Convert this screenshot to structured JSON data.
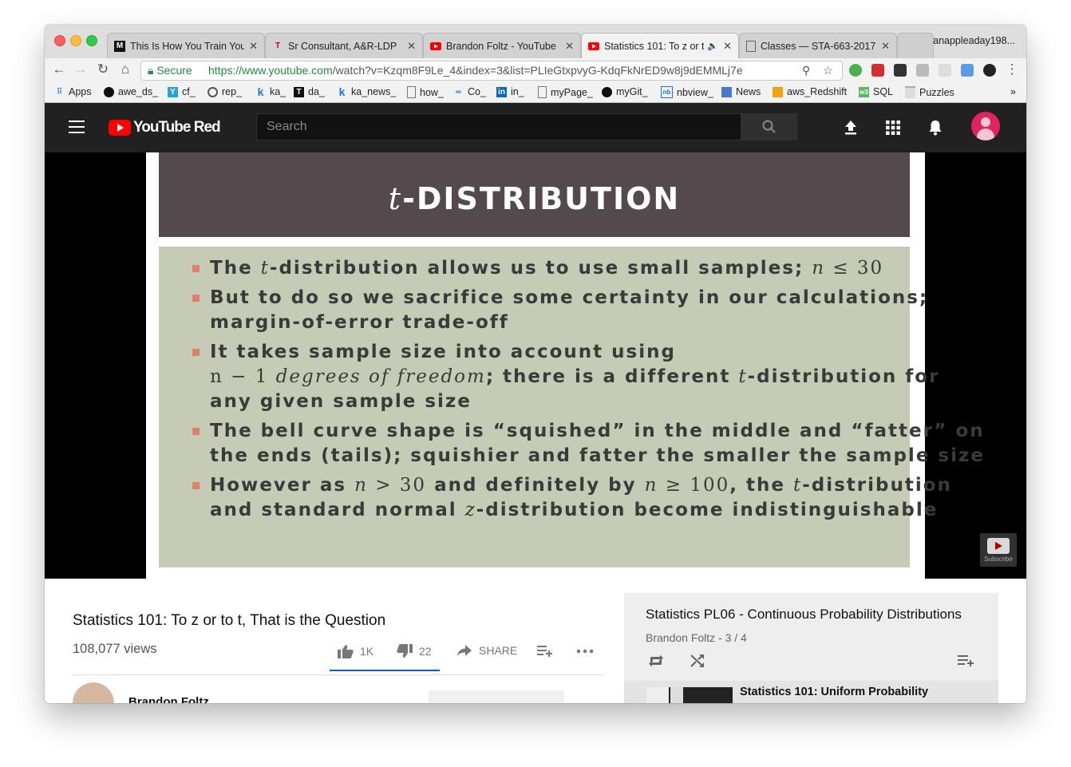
{
  "browser": {
    "tabs": [
      {
        "label": "This Is How You Train Your",
        "icon": "medium-icon"
      },
      {
        "label": "Sr Consultant, A&R-LDP",
        "icon": "tesla-icon"
      },
      {
        "label": "Brandon Foltz - YouTube",
        "icon": "youtube-icon"
      },
      {
        "label": "Statistics 101: To z or t",
        "icon": "youtube-icon",
        "active": true
      },
      {
        "label": "Classes — STA-663-2017",
        "icon": "page-icon"
      }
    ],
    "profile": "anappleaday198...",
    "secure_label": "Secure",
    "url_domain": "https://www.youtube.com",
    "url_rest": "/watch?v=Kzqm8F9Le_4&index=3&list=PLIeGtxpvyG-KdqFkNrED9w8j9dEMMLj7e",
    "bookmarks": [
      {
        "label": "Apps",
        "icon": "apps-icon"
      },
      {
        "label": "awe_ds_",
        "icon": "github-icon"
      },
      {
        "label": "cf_",
        "icon": "cf-icon"
      },
      {
        "label": "rep_",
        "icon": "rep-icon"
      },
      {
        "label": "ka_",
        "icon": "k-icon"
      },
      {
        "label": "da_",
        "icon": "t-icon"
      },
      {
        "label": "ka_news_",
        "icon": "k-icon"
      },
      {
        "label": "how_",
        "icon": "page-icon"
      },
      {
        "label": "Co_",
        "icon": "co-icon"
      },
      {
        "label": "in_",
        "icon": "linkedin-icon"
      },
      {
        "label": "myPage_",
        "icon": "page-icon"
      },
      {
        "label": "myGit_",
        "icon": "github-icon"
      },
      {
        "label": "nbview_",
        "icon": "nb-icon"
      },
      {
        "label": "News",
        "icon": "news-icon"
      },
      {
        "label": "aws_Redshift",
        "icon": "aws-icon"
      },
      {
        "label": "SQL",
        "icon": "sql-icon"
      },
      {
        "label": "Puzzles",
        "icon": "folder-icon"
      }
    ],
    "bookmarks_more": "»"
  },
  "youtube": {
    "logo_text": "YouTube Red",
    "search_placeholder": "Search"
  },
  "slide": {
    "title_italic": "t",
    "title_rest": "-DISTRIBUTION",
    "bullets": [
      {
        "lines": [
          [
            "The ",
            {
              "em": "t"
            },
            "-distribution allows us to use small samples; ",
            {
              "em": "n"
            },
            {
              "m": " ≤ 30"
            }
          ]
        ]
      },
      {
        "lines": [
          [
            "But to do so we sacrifice some certainty in our calculations;"
          ],
          [
            "margin-of-error trade-off"
          ]
        ]
      },
      {
        "lines": [
          [
            "It takes sample size into account using"
          ],
          [
            {
              "m": "n − 1 "
            },
            {
              "em": "degrees of freedom"
            },
            "; there is a different ",
            {
              "em": "t"
            },
            "-distribution for"
          ],
          [
            "any given sample size"
          ]
        ]
      },
      {
        "lines": [
          [
            "The bell curve shape is “squished” in the middle and “fatter” on"
          ],
          [
            "the ends (tails); squishier and fatter the smaller the sample size"
          ]
        ]
      },
      {
        "lines": [
          [
            "However as ",
            {
              "em": "n"
            },
            {
              "m": " > 30"
            },
            " and definitely by ",
            {
              "em": "n"
            },
            {
              "m": " ≥ 100"
            },
            ", the ",
            {
              "em": "t"
            },
            "-distribution"
          ],
          [
            "and standard normal ",
            {
              "em": "z"
            },
            "-distribution become indistinguishable"
          ]
        ]
      }
    ],
    "subscribe_label": "Subscribe"
  },
  "video": {
    "title": "Statistics 101: To z or to t, That is the Question",
    "views": "108,077 views",
    "likes": "1K",
    "dislikes": "22",
    "share": "SHARE",
    "channel": "Brandon Foltz"
  },
  "playlist": {
    "title": "Statistics PL06 - Continuous Probability Distributions",
    "subtitle": "Brandon Foltz - 3 / 4",
    "item_title": "Statistics 101: Uniform Probability"
  }
}
